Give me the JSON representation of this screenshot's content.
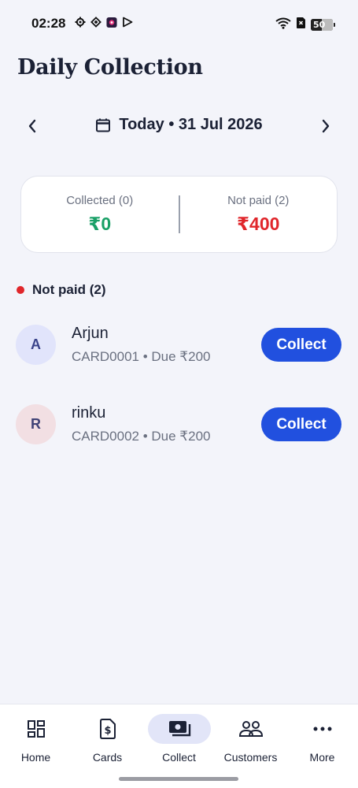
{
  "status_bar": {
    "time": "02:28",
    "battery": "50",
    "battery_level": 0.5,
    "icons_left": [
      "settings-icon",
      "diamond-icon",
      "app-icon",
      "play-icon"
    ],
    "icons_right": [
      "wifi-icon",
      "sim-icon",
      "battery-icon"
    ]
  },
  "header": {
    "title": "Daily Collection"
  },
  "date_nav": {
    "label": "Today • 31 Jul 2026",
    "prev_icon": "chevron-left-icon",
    "next_icon": "chevron-right-icon",
    "calendar_icon": "calendar-icon"
  },
  "summary": {
    "collected_label": "Collected (0)",
    "collected_value": "₹0",
    "not_paid_label": "Not paid (2)",
    "not_paid_value": "₹400",
    "colors": {
      "collected": "#1aa067",
      "not_paid": "#e0262b"
    }
  },
  "section": {
    "label": "Not paid (2)",
    "dot_color": "#e0262b"
  },
  "customers": [
    {
      "initial": "A",
      "name": "Arjun",
      "detail": "CARD0001 • Due ₹200",
      "button": "Collect"
    },
    {
      "initial": "R",
      "name": "rinku",
      "detail": "CARD0002 • Due ₹200",
      "button": "Collect"
    }
  ],
  "bottom_nav": {
    "items": [
      {
        "label": "Home",
        "icon": "dashboard-icon"
      },
      {
        "label": "Cards",
        "icon": "card-dollar-icon"
      },
      {
        "label": "Collect",
        "icon": "cash-icon",
        "active": true
      },
      {
        "label": "Customers",
        "icon": "people-icon"
      },
      {
        "label": "More",
        "icon": "more-dots-icon"
      }
    ]
  },
  "colors": {
    "accent": "#2150df",
    "background": "#f3f4fa",
    "active_nav_bg": "#e2e5f8"
  }
}
